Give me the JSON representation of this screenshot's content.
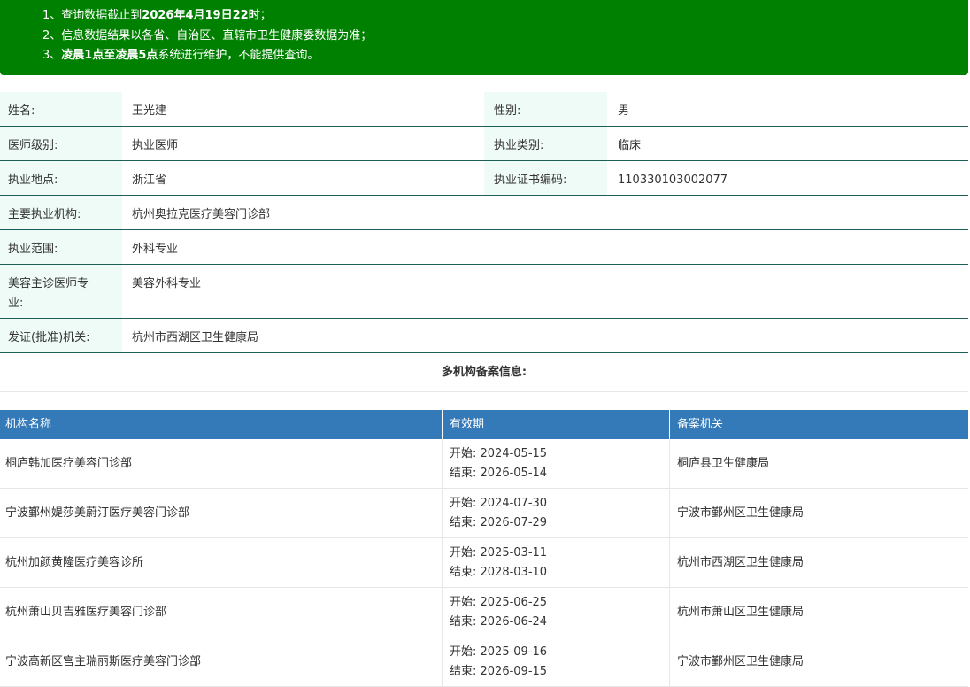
{
  "notice": {
    "line1_a": "1、查询数据截止到",
    "line1_b": "2026年4月19日22时",
    "line1_c": "；",
    "line2": "2、信息数据结果以各省、自治区、直辖市卫生健康委数据为准；",
    "line3_a": "3、",
    "line3_b": "凌晨1点至凌晨5点",
    "line3_c": "系统进行维护，不能提供查询。"
  },
  "info": {
    "name_label": "姓名:",
    "name": "王光建",
    "gender_label": "性别:",
    "gender": "男",
    "level_label": "医师级别:",
    "level": "执业医师",
    "category_label": "执业类别:",
    "category": "临床",
    "location_label": "执业地点:",
    "location": "浙江省",
    "cert_label": "执业证书编码:",
    "cert": "110330103002077",
    "org_label": "主要执业机构:",
    "org": "杭州奥拉克医疗美容门诊部",
    "scope_label": "执业范围:",
    "scope": "外科专业",
    "cosmetic_label_1": "美容主诊医师专",
    "cosmetic_label_2": "业:",
    "cosmetic": "美容外科专业",
    "issuer_label": "发证(批准)机关:",
    "issuer": "杭州市西湖区卫生健康局"
  },
  "multi_title": "多机构备案信息:",
  "table": {
    "headers": [
      "机构名称",
      "有效期",
      "备案机关"
    ],
    "rows": [
      {
        "org": "桐庐韩加医疗美容门诊部",
        "start": "开始:  2024-05-15",
        "end": "结束:  2026-05-14",
        "authority": "桐庐县卫生健康局"
      },
      {
        "org": "宁波鄞州媞莎美蔚汀医疗美容门诊部",
        "start": "开始:  2024-07-30",
        "end": "结束:  2026-07-29",
        "authority": "宁波市鄞州区卫生健康局"
      },
      {
        "org": "杭州加颜黄隆医疗美容诊所",
        "start": "开始:  2025-03-11",
        "end": "结束:  2028-03-10",
        "authority": "杭州市西湖区卫生健康局"
      },
      {
        "org": "杭州萧山贝吉雅医疗美容门诊部",
        "start": "开始:  2025-06-25",
        "end": "结束:  2026-06-24",
        "authority": "杭州市萧山区卫生健康局"
      },
      {
        "org": "宁波高新区宫主瑞丽斯医疗美容门诊部",
        "start": "开始:  2025-09-16",
        "end": "结束:  2026-09-15",
        "authority": "宁波市鄞州区卫生健康局"
      }
    ]
  }
}
